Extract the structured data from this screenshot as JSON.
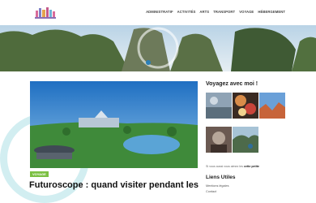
{
  "nav": {
    "items": [
      "Administratif",
      "Activités",
      "Arts",
      "Transport",
      "Voyage",
      "Hébergement"
    ]
  },
  "post": {
    "category": "Voyage",
    "title": "Futuroscope : quand visiter pendant les"
  },
  "sidebar": {
    "title": "Voyagez avec moi !",
    "follow_text": "Si vous aussi vous aimez les",
    "follow_link": "cette petite",
    "links_title": "Liens Utiles",
    "links": [
      "Mentions légales",
      "Contact"
    ]
  },
  "colors": {
    "accent_green": "#7cc043",
    "deco_cyan": "#7fcdd6"
  }
}
